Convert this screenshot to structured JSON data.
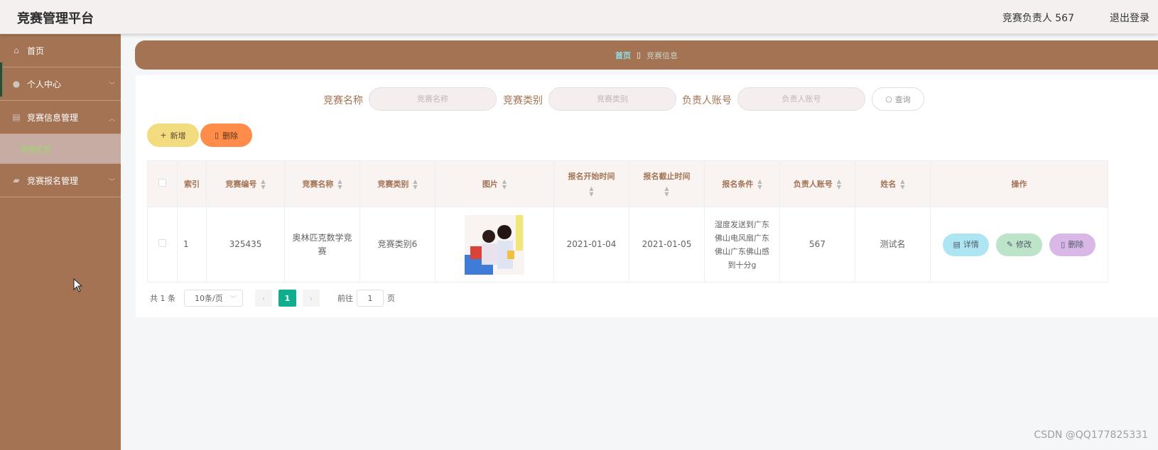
{
  "header": {
    "title": "竞赛管理平台",
    "user": "竞赛负责人 567",
    "logout": "退出登录"
  },
  "sidebar": {
    "items": [
      {
        "label": "首页",
        "icon": "home-icon"
      },
      {
        "label": "个人中心",
        "icon": "user-icon"
      },
      {
        "label": "竞赛信息管理",
        "icon": "folder-icon"
      },
      {
        "label": "竞赛信息"
      },
      {
        "label": "竞赛报名管理",
        "icon": "collection-icon"
      }
    ]
  },
  "breadcrumb": {
    "home": "首页",
    "separator": "▯",
    "current": "竞赛信息"
  },
  "search": {
    "name_label": "竞赛名称",
    "name_placeholder": "竞赛名称",
    "category_label": "竞赛类别",
    "category_placeholder": "竞赛类别",
    "account_label": "负责人账号",
    "account_placeholder": "负责人账号",
    "query_button": "查询"
  },
  "actions": {
    "add": "新增",
    "delete": "删除"
  },
  "table": {
    "headers": {
      "index": "索引",
      "code": "竞赛编号",
      "name": "竞赛名称",
      "category": "竞赛类别",
      "image": "图片",
      "start": "报名开始时间",
      "end": "报名截止时间",
      "condition": "报名条件",
      "account": "负责人账号",
      "person": "姓名",
      "ops": "操作"
    },
    "rows": [
      {
        "index": "1",
        "code": "325435",
        "name": "奥林匹克数学竞赛",
        "category": "竞赛类别6",
        "start": "2021-01-04",
        "end": "2021-01-05",
        "condition": "湿度发送到广东佛山电风扇广东佛山广东佛山感到十分g",
        "account": "567",
        "person": "测试名",
        "detail": "详情",
        "edit": "修改",
        "delete": "删除"
      }
    ]
  },
  "pagination": {
    "total": "共 1 条",
    "page_size": "10条/页",
    "current_page": "1",
    "goto_label": "前往",
    "goto_value": "1",
    "page_suffix": "页"
  },
  "watermark": "CSDN @QQ177825331",
  "colors": {
    "sidebar": "#a37354",
    "accent_green": "#0fae8f",
    "add_button": "#f3dc80",
    "delete_button": "#ff8c4a"
  }
}
